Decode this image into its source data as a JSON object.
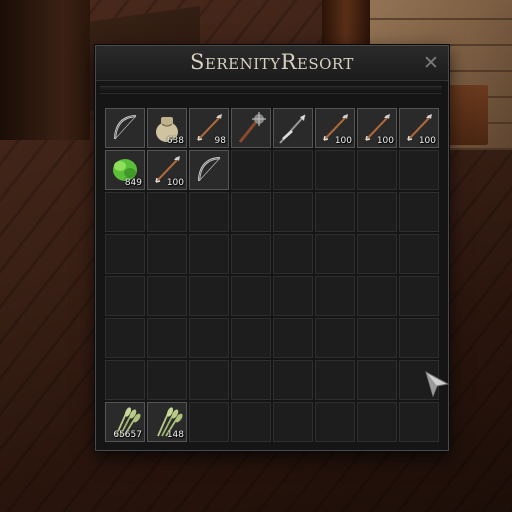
{
  "window": {
    "title": "SerenityResort",
    "close_label": "✕"
  },
  "slots": [
    {
      "item": "bow-icon",
      "qty": ""
    },
    {
      "item": "flour-sack-icon",
      "qty": "638"
    },
    {
      "item": "arrow-icon",
      "qty": "98"
    },
    {
      "item": "mace-icon",
      "qty": ""
    },
    {
      "item": "spear-icon",
      "qty": ""
    },
    {
      "item": "arrow-icon",
      "qty": "100"
    },
    {
      "item": "arrow-icon",
      "qty": "100"
    },
    {
      "item": "arrow-icon",
      "qty": "100"
    },
    {
      "item": "herb-bundle-icon",
      "qty": "849"
    },
    {
      "item": "arrow-icon",
      "qty": "100"
    },
    {
      "item": "bow-icon",
      "qty": ""
    },
    {
      "item": "",
      "qty": ""
    },
    {
      "item": "",
      "qty": ""
    },
    {
      "item": "",
      "qty": ""
    },
    {
      "item": "",
      "qty": ""
    },
    {
      "item": "",
      "qty": ""
    },
    {
      "item": "",
      "qty": ""
    },
    {
      "item": "",
      "qty": ""
    },
    {
      "item": "",
      "qty": ""
    },
    {
      "item": "",
      "qty": ""
    },
    {
      "item": "",
      "qty": ""
    },
    {
      "item": "",
      "qty": ""
    },
    {
      "item": "",
      "qty": ""
    },
    {
      "item": "",
      "qty": ""
    },
    {
      "item": "",
      "qty": ""
    },
    {
      "item": "",
      "qty": ""
    },
    {
      "item": "",
      "qty": ""
    },
    {
      "item": "",
      "qty": ""
    },
    {
      "item": "",
      "qty": ""
    },
    {
      "item": "",
      "qty": ""
    },
    {
      "item": "",
      "qty": ""
    },
    {
      "item": "",
      "qty": ""
    },
    {
      "item": "",
      "qty": ""
    },
    {
      "item": "",
      "qty": ""
    },
    {
      "item": "",
      "qty": ""
    },
    {
      "item": "",
      "qty": ""
    },
    {
      "item": "",
      "qty": ""
    },
    {
      "item": "",
      "qty": ""
    },
    {
      "item": "",
      "qty": ""
    },
    {
      "item": "",
      "qty": ""
    },
    {
      "item": "",
      "qty": ""
    },
    {
      "item": "",
      "qty": ""
    },
    {
      "item": "",
      "qty": ""
    },
    {
      "item": "",
      "qty": ""
    },
    {
      "item": "",
      "qty": ""
    },
    {
      "item": "",
      "qty": ""
    },
    {
      "item": "",
      "qty": ""
    },
    {
      "item": "",
      "qty": ""
    },
    {
      "item": "",
      "qty": ""
    },
    {
      "item": "",
      "qty": ""
    },
    {
      "item": "",
      "qty": ""
    },
    {
      "item": "",
      "qty": ""
    },
    {
      "item": "",
      "qty": ""
    },
    {
      "item": "",
      "qty": ""
    },
    {
      "item": "",
      "qty": ""
    },
    {
      "item": "",
      "qty": ""
    },
    {
      "item": "wheat-bundle-icon",
      "qty": "65657"
    },
    {
      "item": "wheat-bundle-icon",
      "qty": "148"
    },
    {
      "item": "",
      "qty": ""
    },
    {
      "item": "",
      "qty": ""
    },
    {
      "item": "",
      "qty": ""
    },
    {
      "item": "",
      "qty": ""
    },
    {
      "item": "",
      "qty": ""
    },
    {
      "item": "",
      "qty": ""
    }
  ],
  "colors": {
    "panel": "#151515",
    "slot": "#1d1d1d",
    "slot_filled": "#2a2a2a",
    "title": "#d8d0c0"
  }
}
